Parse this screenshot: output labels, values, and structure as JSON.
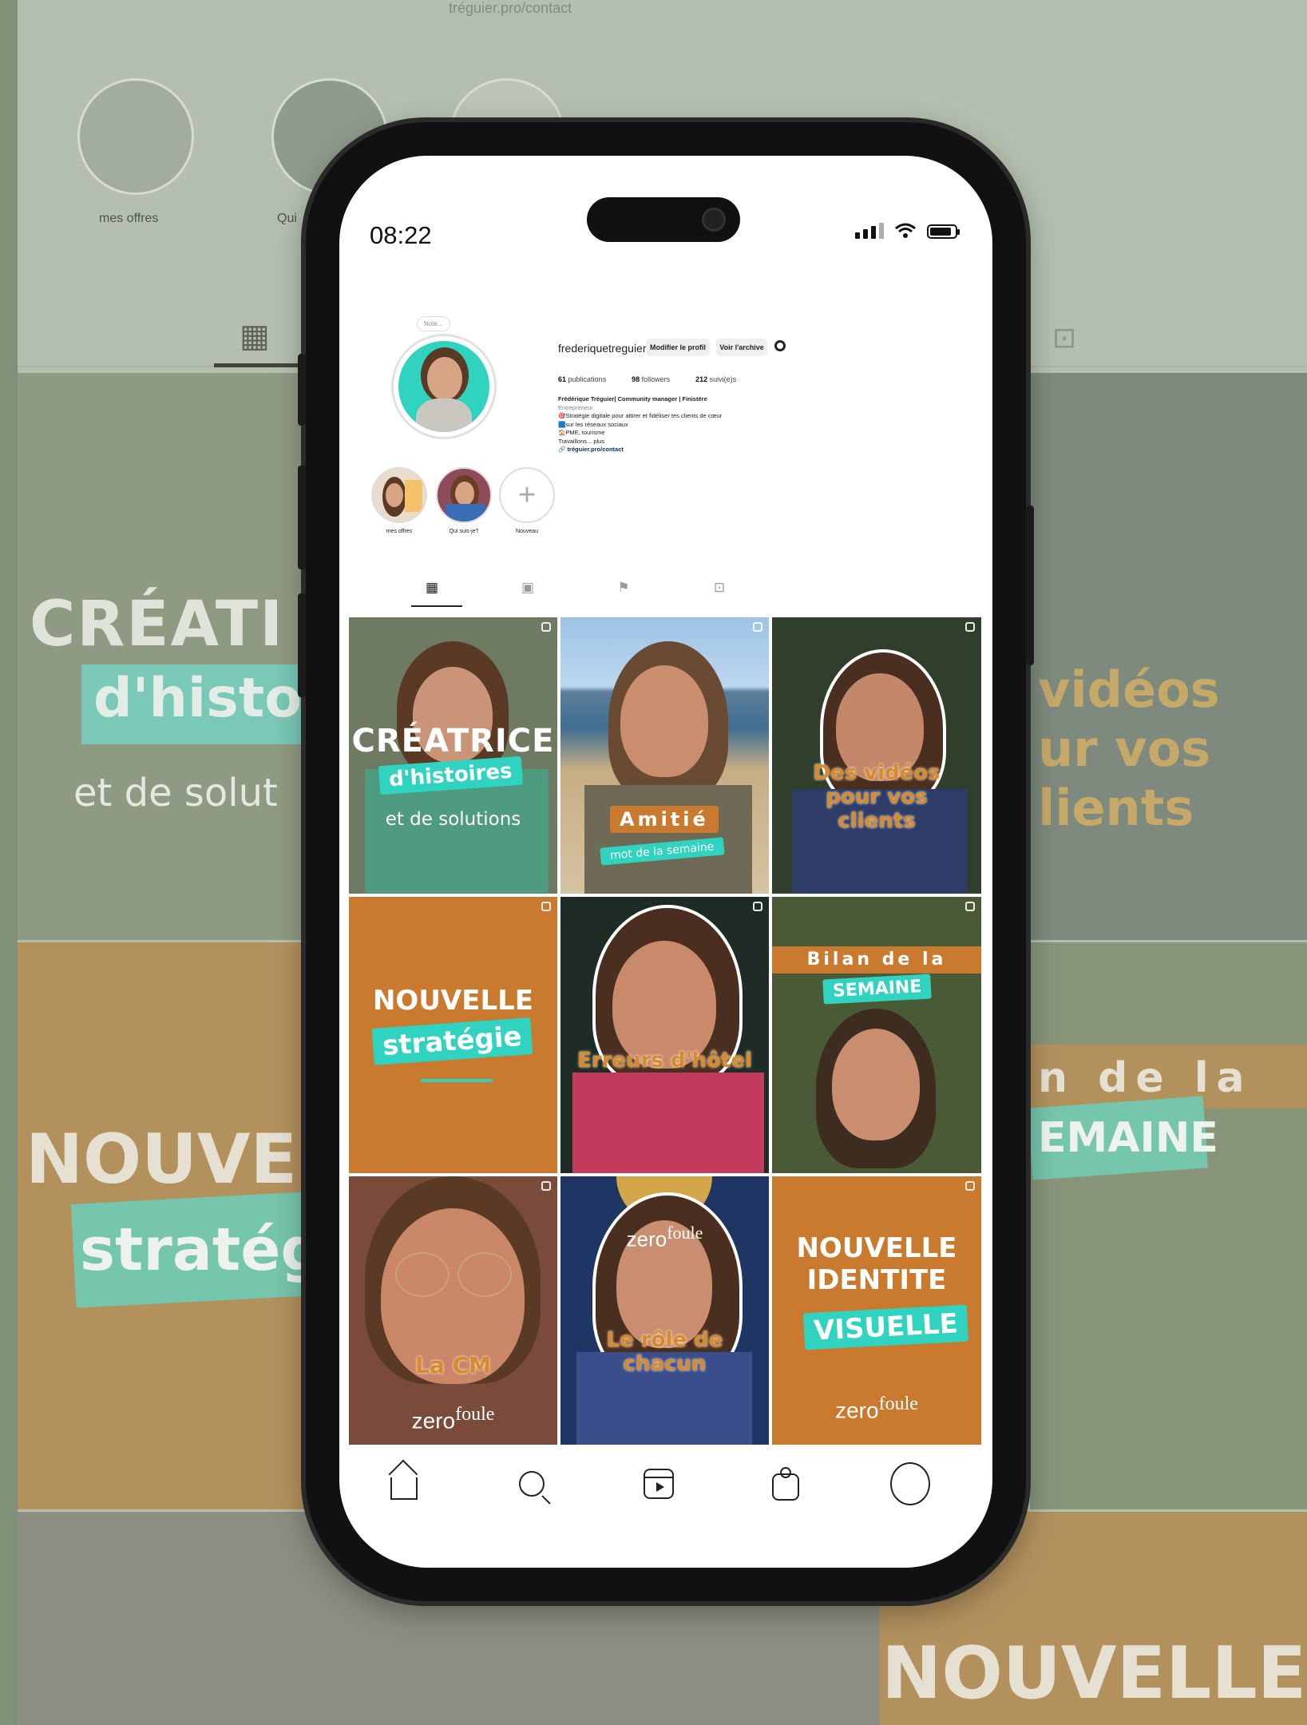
{
  "background": {
    "handle": "tréguier.pro/contact",
    "highlight_label": "mes offres",
    "highlight_label_2": "Qui"
  },
  "status_bar": {
    "time": "08:22"
  },
  "profile": {
    "username": "frederiquetreguier",
    "edit_button": "Modifier le profil",
    "archive_button": "Voir l'archive",
    "note": "Note...",
    "stats": [
      {
        "value": "61",
        "label": "publications"
      },
      {
        "value": "98",
        "label": "followers"
      },
      {
        "value": "212",
        "label": "suivi(e)s"
      }
    ],
    "bio": {
      "name": "Frédérique Tréguier| Community manager | Finistère",
      "category": "Entrepreneur",
      "line1": "🎯Stratégie digitale pour attirer et fidéliser tes clients de cœur",
      "line2": "🟦sur les réseaux sociaux",
      "line3": "🏠PME, tourisme",
      "line4": "Travaillons... plus",
      "link": "tréguier.pro/contact"
    }
  },
  "highlights": [
    {
      "label": "mes offres"
    },
    {
      "label": "Qui suis-je?"
    },
    {
      "label": "Nouveau"
    }
  ],
  "posts": {
    "p1": {
      "title": "CRÉATRICE",
      "chip": "d'histoires",
      "sub": "et de solutions"
    },
    "p2": {
      "chip": "Amitié",
      "sub": "mot de la semaine"
    },
    "p3": {
      "title": "Des vidéos pour vos clients"
    },
    "p4": {
      "title": "NOUVELLE",
      "chip": "stratégie"
    },
    "p5": {
      "title": "Erreurs d'hôtel"
    },
    "p6": {
      "title": "Bilan de la",
      "chip": "SEMAINE"
    },
    "p7": {
      "title": "La CM",
      "brand_a": "zero",
      "brand_b": "foule"
    },
    "p8": {
      "title": "Le rôle de chacun",
      "brand_a": "zero",
      "brand_b": "foule"
    },
    "p9": {
      "title1": "NOUVELLE",
      "title2": "IDENTITE",
      "chip": "VISUELLE",
      "brand_a": "zero",
      "brand_b": "foule"
    }
  },
  "colors": {
    "orange": "#c97a2e",
    "teal": "#2fd3bf",
    "navy": "#1f3563"
  },
  "icons": [
    "grid-icon",
    "reels-icon",
    "saved-icon",
    "tagged-icon",
    "home-icon",
    "search-icon",
    "reels-icon",
    "shop-icon",
    "profile-icon"
  ]
}
